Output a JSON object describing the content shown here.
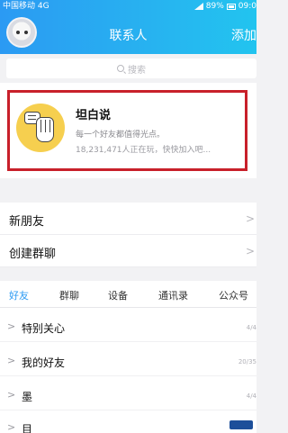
{
  "status_bar": {
    "carrier": "中国移动 4G",
    "battery": "89%",
    "time": "09:0"
  },
  "header": {
    "title": "联系人",
    "add_label": "添加"
  },
  "search": {
    "placeholder": "搜索"
  },
  "promo": {
    "title": "坦白说",
    "subtitle": "每一个好友都值得光点。",
    "online": "18,231,471人正在玩，快快加入吧..."
  },
  "rows": [
    {
      "label": "新朋友"
    },
    {
      "label": "创建群聊"
    }
  ],
  "tabs": [
    {
      "label": "好友",
      "active": true
    },
    {
      "label": "群聊"
    },
    {
      "label": "设备"
    },
    {
      "label": "通讯录"
    },
    {
      "label": "公众号"
    }
  ],
  "groups": [
    {
      "name": "特别关心",
      "count": "4/4"
    },
    {
      "name": "我的好友",
      "count": "20/35"
    },
    {
      "name": "墨",
      "count": "4/4"
    },
    {
      "name": "目",
      "count": ""
    }
  ],
  "colors": {
    "accent": "#2b9af3",
    "highlight_border": "#c8202a",
    "icon_yellow": "#f6cf4f"
  }
}
